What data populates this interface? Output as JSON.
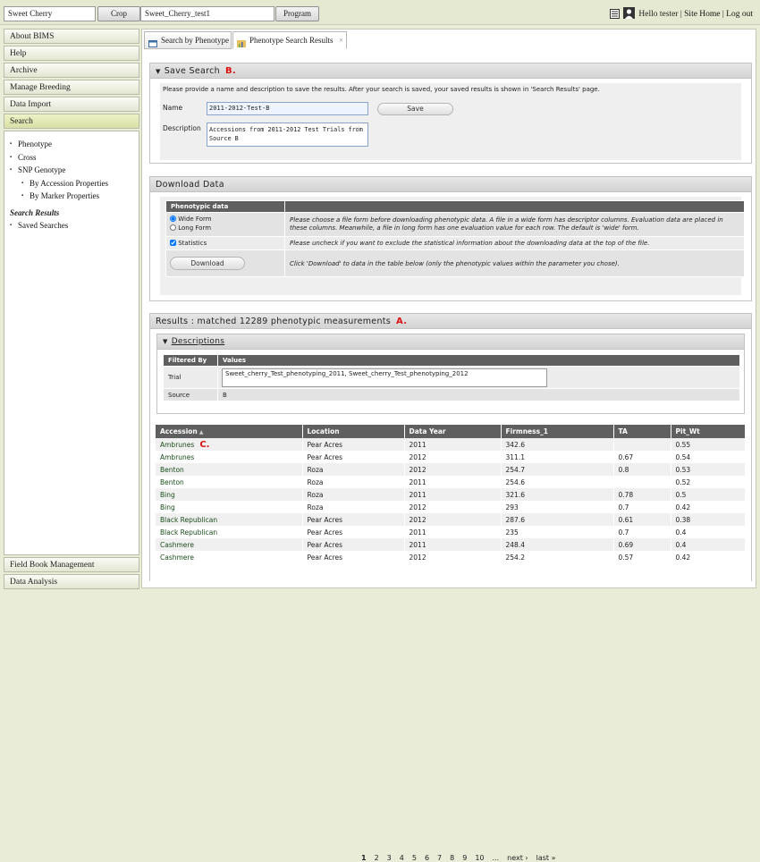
{
  "topbar": {
    "crop_field": "Sweet Cherry",
    "crop_button": "Crop",
    "program_field": "Sweet_Cherry_test1",
    "program_button": "Program",
    "greeting": "Hello tester",
    "site_home": "Site Home",
    "logout": "Log out",
    "sep": "|"
  },
  "sidebar": {
    "top_items": [
      "About BIMS",
      "Help",
      "Archive",
      "Manage Breeding",
      "Data Import",
      "Search"
    ],
    "links": {
      "phenotype": "Phenotype",
      "cross": "Cross",
      "snp": "SNP Genotype",
      "by_accession": "By Accession Properties",
      "by_marker": "By Marker Properties",
      "search_results": "Search Results",
      "saved_searches": "Saved Searches"
    },
    "bottom_items": [
      "Field Book Management",
      "Data Analysis"
    ]
  },
  "tabs": {
    "search": "Search by Phenotype",
    "results": "Phenotype Search Results",
    "close": "×"
  },
  "save": {
    "title": "Save Search",
    "marker": "B.",
    "instructions": "Please provide a name and description to save the results. After your search is saved, your saved results is shown in 'Search Results' page.",
    "name_label": "Name",
    "name_value": "2011-2012-Test-B",
    "desc_label": "Description",
    "desc_value": "Accessions from 2011-2012 Test Trials from Source B",
    "button": "Save"
  },
  "download": {
    "title": "Download Data",
    "header": "Phenotypic data",
    "wide": "Wide Form",
    "long": "Long Form",
    "form_help": "Please choose a file form before downloading phenotypic data. A file in a wide form has descriptor columns. Evaluation data are placed in these columns. Meanwhile, a file in long form has one evaluation value for each row. The default is 'wide' form.",
    "stats": "Statistics",
    "stats_help": "Please uncheck if you want to exclude the statistical information about the downloading data at the top of the file.",
    "button": "Download",
    "button_help": "Click 'Download' to data in the table below (only the phenotypic values within the parameter you chose)."
  },
  "results": {
    "title": "Results : matched 12289 phenotypic measurements",
    "marker": "A.",
    "descriptions": "Descriptions",
    "filtered_by": "Filtered By",
    "values": "Values",
    "trial_label": "Trial",
    "trial_value": "Sweet_cherry_Test_phenotyping_2011, Sweet_cherry_Test_phenotyping_2012",
    "source_label": "Source",
    "source_value": "B",
    "row_marker": "C.",
    "columns": [
      "Accession",
      "Location",
      "Data Year",
      "Firmness_1",
      "TA",
      "Pit_Wt"
    ],
    "rows": [
      [
        "Ambrunes",
        "Pear Acres",
        "2011",
        "342.6",
        "",
        "0.55"
      ],
      [
        "Ambrunes",
        "Pear Acres",
        "2012",
        "311.1",
        "0.67",
        "0.54"
      ],
      [
        "Benton",
        "Roza",
        "2012",
        "254.7",
        "0.8",
        "0.53"
      ],
      [
        "Benton",
        "Roza",
        "2011",
        "254.6",
        "",
        "0.52"
      ],
      [
        "Bing",
        "Roza",
        "2011",
        "321.6",
        "0.78",
        "0.5"
      ],
      [
        "Bing",
        "Roza",
        "2012",
        "293",
        "0.7",
        "0.42"
      ],
      [
        "Black Republican",
        "Pear Acres",
        "2012",
        "287.6",
        "0.61",
        "0.38"
      ],
      [
        "Black Republican",
        "Pear Acres",
        "2011",
        "235",
        "0.7",
        "0.4"
      ],
      [
        "Cashmere",
        "Pear Acres",
        "2011",
        "248.4",
        "0.69",
        "0.4"
      ],
      [
        "Cashmere",
        "Pear Acres",
        "2012",
        "254.2",
        "0.57",
        "0.42"
      ]
    ]
  },
  "pager": {
    "pages": [
      "1",
      "2",
      "3",
      "4",
      "5",
      "6",
      "7",
      "8",
      "9",
      "10"
    ],
    "ellipsis": "...",
    "next": "next ›",
    "last": "last »"
  },
  "colors": {
    "accent": "#d11111",
    "header_dark": "#5f5f5f",
    "link_green": "#1a4d1a"
  }
}
